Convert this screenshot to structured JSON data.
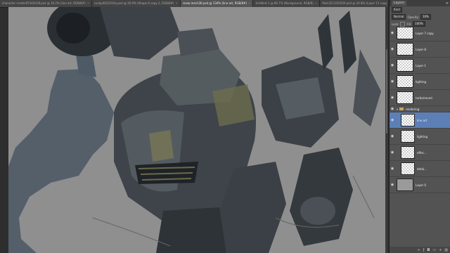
{
  "tabs": [
    {
      "label": "character render05162018.psd @ 16.2% (line art, RGB/8#)",
      "active": false
    },
    {
      "label": "cockpit021016a.psd @ 20.9% (Shape 6 copy 2, RGB/8#)",
      "active": false
    },
    {
      "label": "snow mech36.psd @ 134% (line art, RGB/8#)",
      "active": true
    },
    {
      "label": "Untitled-1 @ 66.7% (Background, RGB/8)",
      "active": false
    },
    {
      "label": "fleet EC1220520.psd @ 24.8% (Layer 11 copy 3, RGB/8#)",
      "active": false
    }
  ],
  "panel": {
    "tab": "Layers",
    "kind": "Kind",
    "blend_mode": "Normal",
    "opacity_label": "Opacity:",
    "opacity_value": "10%",
    "lock_label": "Lock:",
    "fill_label": "Fill:",
    "fill_value": "100%"
  },
  "layers": [
    {
      "name": "Layer 7 copy",
      "type": "layer"
    },
    {
      "name": "Layer 8",
      "type": "layer"
    },
    {
      "name": "Layer 1",
      "type": "layer"
    },
    {
      "name": "lighting",
      "type": "layer"
    },
    {
      "name": "turbo/round",
      "type": "layer"
    },
    {
      "name": "rendering",
      "type": "group"
    },
    {
      "name": "line art",
      "type": "layer",
      "selected": true
    },
    {
      "name": "lighting",
      "type": "layer"
    },
    {
      "name": "effec...",
      "type": "layer"
    },
    {
      "name": "detai...",
      "type": "layer"
    },
    {
      "name": "Layer 0",
      "type": "layer",
      "gray": true
    }
  ],
  "colors": {
    "canvas": "#8f8f8f",
    "mech_dark": "#2f3439",
    "mech_mid": "#4c5258",
    "accent": "#8a8a5a",
    "sketch": "#4e5a66"
  }
}
